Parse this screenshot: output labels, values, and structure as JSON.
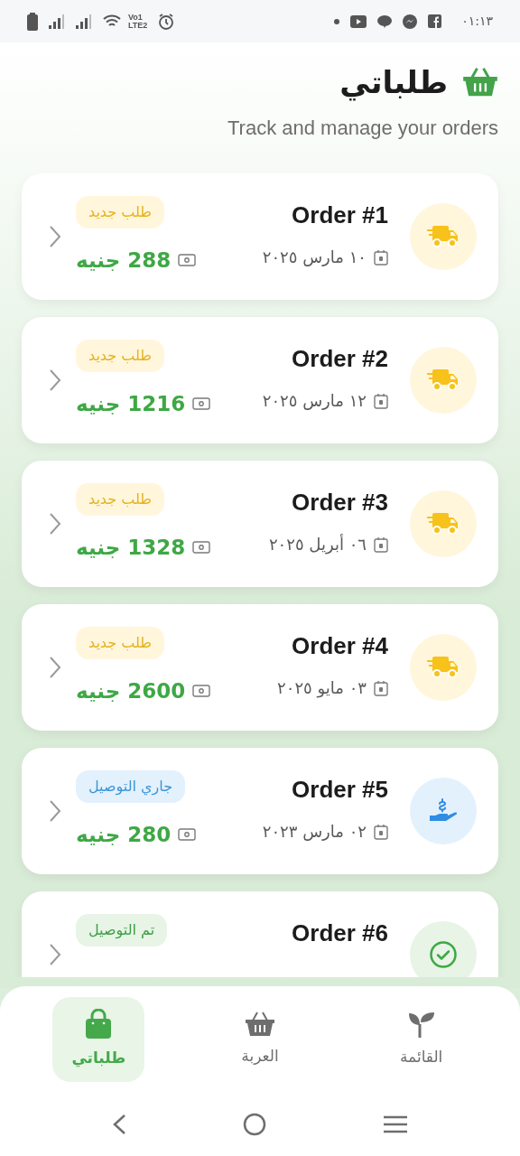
{
  "status_bar": {
    "time": "٠١:١٣",
    "network_label": [
      "Vo1",
      "LTE2"
    ]
  },
  "header": {
    "title": "طلباتي",
    "subtitle": "Track and manage your orders"
  },
  "orders": [
    {
      "title": "Order #1",
      "date": "١٠ مارس ٢٠٢٥",
      "amount": "288",
      "currency": "جنيه",
      "status": "طلب جديد",
      "kind": "new"
    },
    {
      "title": "Order #2",
      "date": "١٢ مارس ٢٠٢٥",
      "amount": "1216",
      "currency": "جنيه",
      "status": "طلب جديد",
      "kind": "new"
    },
    {
      "title": "Order #3",
      "date": "٠٦ أبريل ٢٠٢٥",
      "amount": "1328",
      "currency": "جنيه",
      "status": "طلب جديد",
      "kind": "new"
    },
    {
      "title": "Order #4",
      "date": "٠٣ مايو ٢٠٢٥",
      "amount": "2600",
      "currency": "جنيه",
      "status": "طلب جديد",
      "kind": "new"
    },
    {
      "title": "Order #5",
      "date": "٠٢ مارس ٢٠٢٣",
      "amount": "280",
      "currency": "جنيه",
      "status": "جاري التوصيل",
      "kind": "delivering"
    },
    {
      "title": "Order #6",
      "status": "تم التوصيل",
      "kind": "delivered"
    }
  ],
  "bottom_nav": [
    {
      "label": "القائمة",
      "selected": false
    },
    {
      "label": "العربة",
      "selected": false
    },
    {
      "label": "طلباتي",
      "selected": true
    }
  ]
}
